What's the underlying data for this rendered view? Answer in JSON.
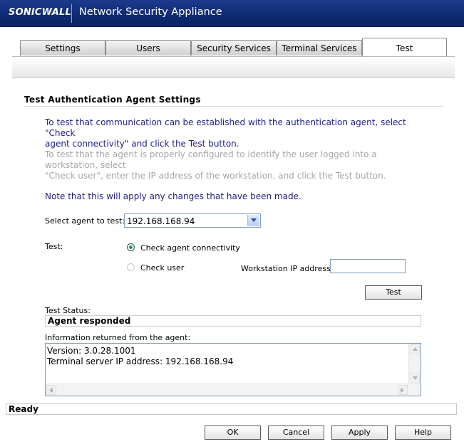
{
  "header": {
    "logo_text": "SONICWALL",
    "title": "Network Security Appliance",
    "background_color": "#12307c"
  },
  "tabs": [
    {
      "label": "Settings",
      "active": false
    },
    {
      "label": "Users",
      "active": false
    },
    {
      "label": "Security Services",
      "active": false
    },
    {
      "label": "Terminal Services",
      "active": false
    },
    {
      "label": "Test",
      "active": true
    }
  ],
  "section": {
    "title": "Test Authentication Agent Settings",
    "para1_line1": "To test that communication can be established with the authentication agent, select \"Check",
    "para1_line2": "agent connectivity\" and click the Test button.",
    "para2_line1": "To test that the agent is properly configured to identify the user logged into a workstation, select",
    "para2_line2": "\"Check user\", enter the IP address of the workstation, and click the Test button.",
    "note": "Note that this will apply any changes that have been made."
  },
  "form": {
    "agent_label": "Select agent to test:",
    "agent_value": "192.168.168.94",
    "test_label": "Test:",
    "radio_connectivity_label": "Check agent connectivity",
    "radio_connectivity_checked": true,
    "radio_user_label": "Check user",
    "radio_user_checked": false,
    "workstation_label": "Workstation IP address:",
    "workstation_value": "",
    "test_button_label": "Test"
  },
  "status": {
    "label": "Test Status:",
    "value": "Agent responded"
  },
  "info": {
    "label": "Information returned from the agent:",
    "lines": [
      "Version: 3.0.28.1001",
      "Terminal server IP address: 192.168.168.94"
    ]
  },
  "statusbar": {
    "text": "Ready"
  },
  "footer": {
    "ok_label": "OK",
    "cancel_label": "Cancel",
    "apply_label": "Apply",
    "help_label": "Help"
  },
  "colors": {
    "instruction_blue": "#1c1c8a",
    "disabled_gray": "#a6a6a6",
    "radio_selected_green": "#21a121"
  }
}
